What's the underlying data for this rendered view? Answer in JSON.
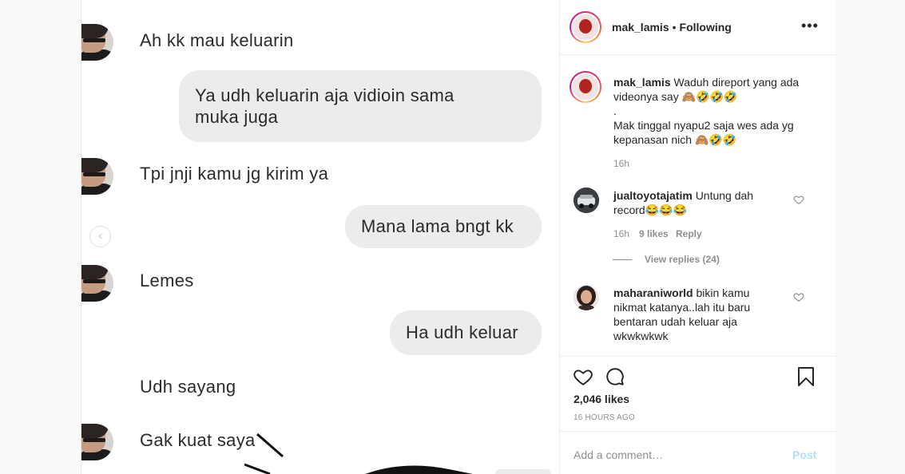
{
  "chat": {
    "messages": [
      {
        "side": "in",
        "text": "Ah kk mau keluarin"
      },
      {
        "side": "out",
        "lines": [
          "Ya udh keluarin aja vidioin sama",
          "muka juga"
        ]
      },
      {
        "side": "in",
        "text": "Tpi jnji kamu jg kirim ya"
      },
      {
        "side": "out",
        "text": "Mana lama bngt kk"
      },
      {
        "side": "in",
        "text": "Lemes"
      },
      {
        "side": "out",
        "text": "Ha udh keluar"
      },
      {
        "side": "in",
        "text": "Udh sayang"
      },
      {
        "side": "in",
        "text": "Gak kuat saya"
      }
    ],
    "prev_icon": "chevron-left-icon"
  },
  "post": {
    "header": {
      "username": "mak_lamis",
      "separator": "•",
      "follow_status": "Following",
      "more_icon": "•••"
    },
    "caption": {
      "username": "mak_lamis",
      "lines": [
        "Waduh direport yang ada",
        "videonya say 🙈🤣🤣🤣",
        ".",
        "Mak tinggal nyapu2 saja wes ada yg",
        "kepanasan nich 🙈🤣🤣"
      ],
      "time": "16h"
    },
    "comments": [
      {
        "username": "jualtoyotajatim",
        "text_lines": [
          "Untung dah",
          "record😂😂😂"
        ],
        "time": "16h",
        "likes": "9 likes",
        "reply": "Reply",
        "view_replies": "View replies (24)"
      },
      {
        "username": "maharaniworld",
        "text_lines": [
          "bikin kamu",
          "nikmat katanya..lah itu baru",
          "bentaran udah keluar aja",
          "wkwkwkwk"
        ]
      }
    ],
    "likes": "2,046 likes",
    "ago": "16 HOURS AGO",
    "add_comment_placeholder": "Add a comment…",
    "post_button": "Post"
  },
  "colors": {
    "chat_bubble": "#ececec",
    "post_button": "#b2dffc",
    "secondary_text": "#8e8e8e"
  }
}
